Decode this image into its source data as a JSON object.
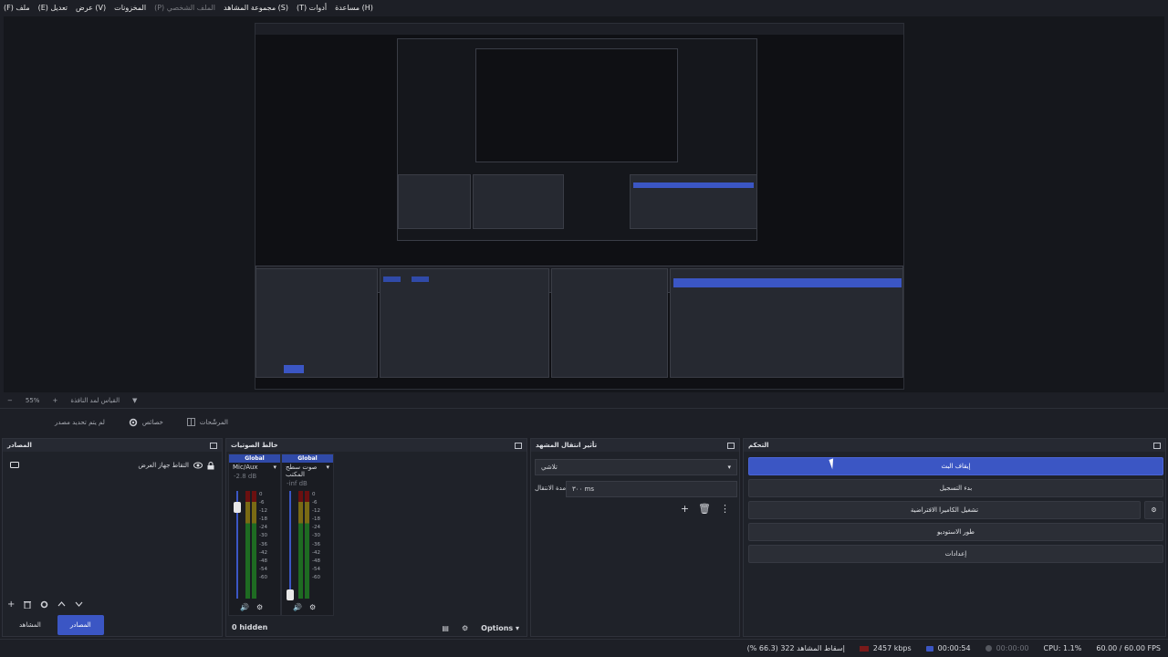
{
  "menu": {
    "file": "(F) ملف",
    "edit": "(E) تعديل",
    "view": "عرض (V)",
    "stores": "المخزونات",
    "profile": "(P) الملف الشخصي",
    "scene_collection": "مجموعة المشاهد (S)",
    "tools": "(T) أدوات",
    "help": "مساعدة (H)"
  },
  "zoom": {
    "minus": "−",
    "level": "55%",
    "plus": "+",
    "preview_label": "القياس لمد النافذة",
    "chevron": "▼"
  },
  "toolbar": {
    "no_source": "لم يتم تحديد مصدر",
    "properties": "خصائص",
    "filters": "المرشّحات"
  },
  "sources": {
    "title": "المصادر",
    "item_label": "التقاط جهاز العرض",
    "tab_scenes": "المشاهد",
    "tab_sources": "المصادر"
  },
  "mixer": {
    "title": "خالط الصوتيات",
    "channels": [
      {
        "head": "Global",
        "name": "Mic/Aux",
        "db": "-2.8 dB"
      },
      {
        "head": "Global",
        "name": "صوت سطح المكتب",
        "db": "-inf dB"
      }
    ],
    "scale": [
      "0",
      "-6",
      "-12",
      "-18",
      "-24",
      "-30",
      "-36",
      "-42",
      "-48",
      "-54",
      "-60"
    ],
    "hidden": "0 hidden",
    "options": "Options"
  },
  "transitions": {
    "title": "تأثير انتقال المشهد",
    "selected": "تلاشي",
    "duration_label": "مدة الانتقال",
    "duration_value": "٣٠٠ ms"
  },
  "controls": {
    "title": "التحكم",
    "stop_stream": "إيقاف البث",
    "start_record": "بدء التسجيل",
    "virtual_camera": "تشغيل الكاميرا الافتراضية",
    "studio_mode": "طور الاستوديو",
    "settings": "إعدادات"
  },
  "status": {
    "dropped": "إسقاط المشاهد 322 (66.3 %)",
    "bitrate": "2457 kbps",
    "stream_time": "00:00:54",
    "record_time": "00:00:00",
    "cpu": "CPU: 1.1%",
    "fps": "60.00 / 60.00 FPS"
  },
  "colors": {
    "accent": "#3b56c4",
    "background": "#1d1f26",
    "panel": "#1f2229"
  }
}
